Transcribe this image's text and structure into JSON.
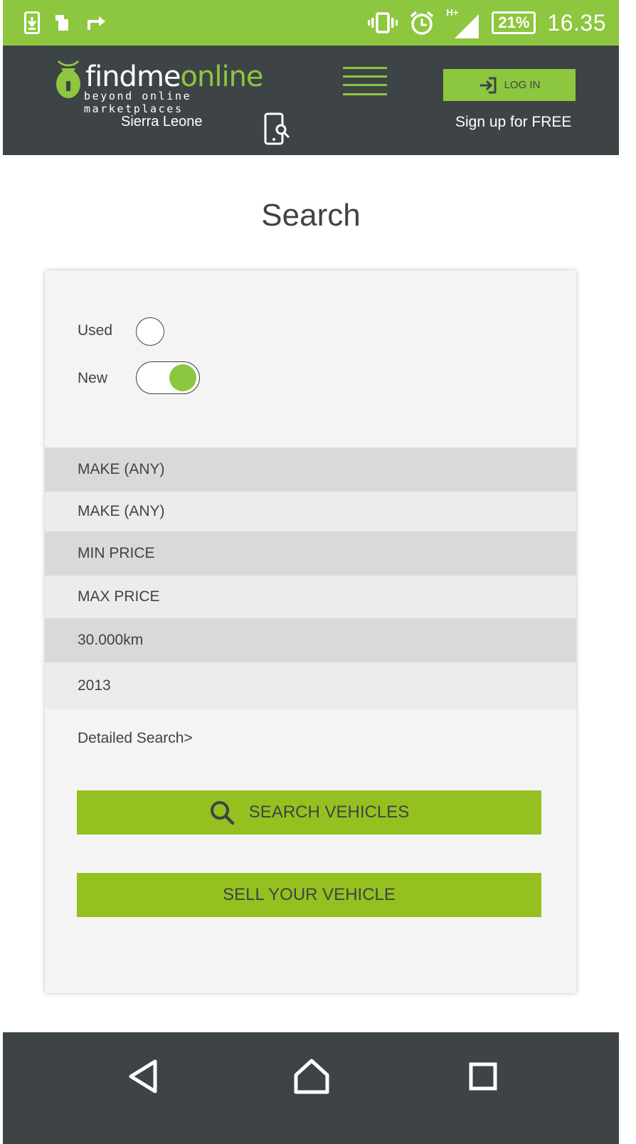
{
  "status_bar": {
    "battery": "21%",
    "time": "16.35",
    "network": "H+",
    "icons": [
      "download-icon",
      "sd-card-icon",
      "share-arrow-icon",
      "vibrate-icon",
      "alarm-icon",
      "signal-icon",
      "battery-icon"
    ]
  },
  "header": {
    "logo_part1": "findme",
    "logo_part2": "online",
    "tagline": "beyond online marketplaces",
    "country": "Sierra Leone",
    "login_label": "LOG IN",
    "signup_label": "Sign up for FREE"
  },
  "page": {
    "title": "Search"
  },
  "search_form": {
    "used_label": "Used",
    "new_label": "New",
    "used_selected": false,
    "new_selected": true,
    "fields": [
      "MAKE (ANY)",
      "MAKE (ANY)",
      "MIN PRICE",
      "MAX PRICE",
      "30.000km",
      "2013"
    ],
    "detailed_search": "Detailed Search>",
    "search_button": "SEARCH VEHICLES",
    "sell_button": "SELL YOUR VEHICLE"
  },
  "colors": {
    "accent": "#8dc63f",
    "button": "#94c11f",
    "header": "#3e4446"
  }
}
